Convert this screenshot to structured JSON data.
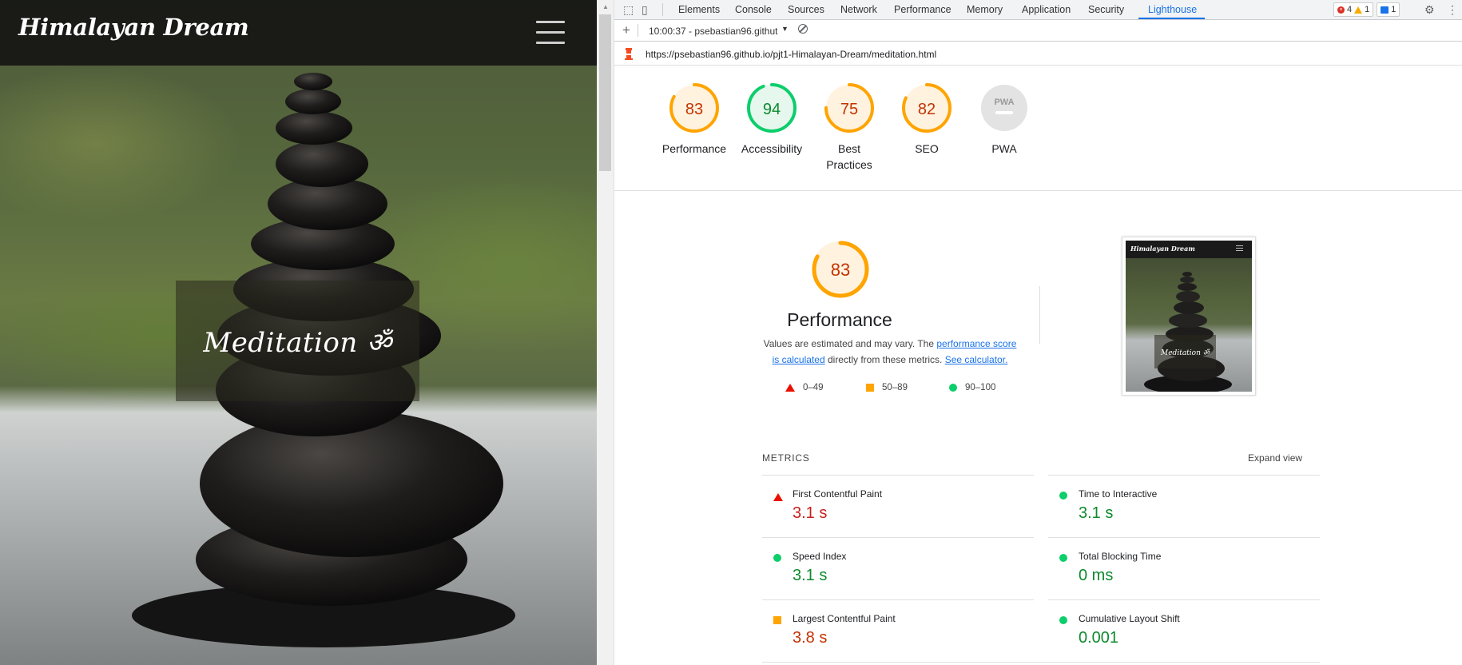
{
  "site": {
    "logo": "Himalayan Dream",
    "hero_title": "Meditation ॐ"
  },
  "devtools": {
    "tabs": [
      "Elements",
      "Console",
      "Sources",
      "Network",
      "Performance",
      "Memory",
      "Application",
      "Security",
      "Lighthouse"
    ],
    "active_tab": "Lighthouse",
    "counts": {
      "errors": "4",
      "warnings": "1",
      "messages": "1"
    },
    "report_selector": "10:00:37 - psebastian96.githut",
    "url": "https://psebastian96.github.io/pjt1-Himalayan-Dream/meditation.html"
  },
  "scores": [
    {
      "label": "Performance",
      "value": "83",
      "fraction": 0.83,
      "status": "average"
    },
    {
      "label": "Accessibility",
      "value": "94",
      "fraction": 0.94,
      "status": "pass"
    },
    {
      "label": "Best Practices",
      "value": "75",
      "fraction": 0.75,
      "status": "average"
    },
    {
      "label": "SEO",
      "value": "82",
      "fraction": 0.82,
      "status": "average"
    },
    {
      "label": "PWA",
      "value": "",
      "fraction": 0,
      "status": "na"
    }
  ],
  "pwa_badge": "PWA",
  "performance": {
    "score": "83",
    "fraction": 0.83,
    "title": "Performance",
    "desc_prefix": "Values are estimated and may vary. The ",
    "desc_link1": "performance score is calculated",
    "desc_middle": " directly from these metrics. ",
    "desc_link2": "See calculator.",
    "legend": [
      {
        "range": "0–49",
        "shape": "triangle"
      },
      {
        "range": "50–89",
        "shape": "square"
      },
      {
        "range": "90–100",
        "shape": "circle"
      }
    ],
    "thumb_logo": "Himalayan Dream",
    "thumb_title": "Meditation ॐ"
  },
  "metrics": {
    "heading": "METRICS",
    "expand_label": "Expand view",
    "items": [
      {
        "name": "First Contentful Paint",
        "value": "3.1 s",
        "status": "fail"
      },
      {
        "name": "Time to Interactive",
        "value": "3.1 s",
        "status": "pass"
      },
      {
        "name": "Speed Index",
        "value": "3.1 s",
        "status": "pass"
      },
      {
        "name": "Total Blocking Time",
        "value": "0 ms",
        "status": "pass"
      },
      {
        "name": "Largest Contentful Paint",
        "value": "3.8 s",
        "status": "average"
      },
      {
        "name": "Cumulative Layout Shift",
        "value": "0.001",
        "status": "pass"
      }
    ]
  },
  "colors": {
    "pass": "#0cce6b",
    "average": "#ffa400",
    "fail": "#eb0f00",
    "accent": "#1a73e8"
  }
}
